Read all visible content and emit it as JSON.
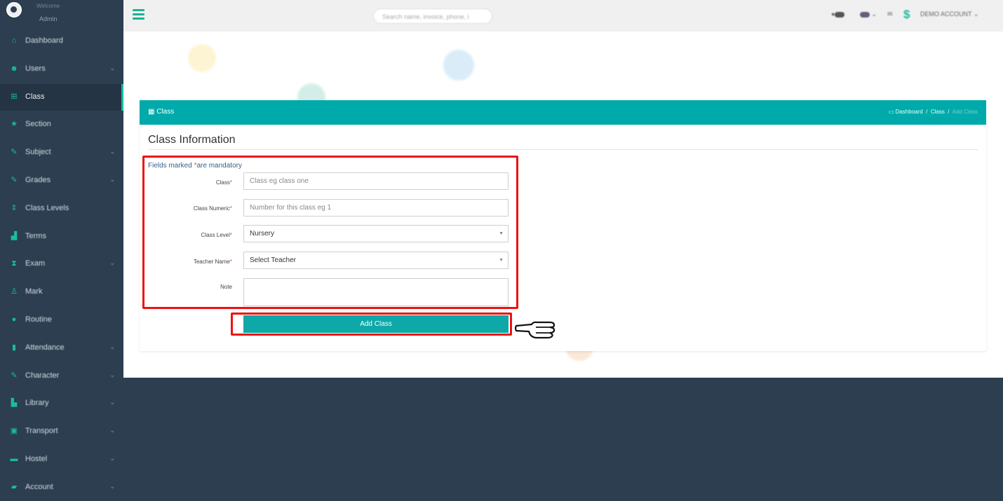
{
  "sidebar": {
    "welcome": "Welcome",
    "user": "Admin",
    "items": [
      {
        "label": "Dashboard",
        "icon": "home-icon",
        "chevron": ""
      },
      {
        "label": "Users",
        "icon": "users-icon",
        "chevron": "⌄"
      },
      {
        "label": "Class",
        "icon": "sitemap-icon",
        "chevron": ""
      },
      {
        "label": "Section",
        "icon": "star-icon",
        "chevron": ""
      },
      {
        "label": "Subject",
        "icon": "edit-icon",
        "chevron": "⌄"
      },
      {
        "label": "Grades",
        "icon": "edit-icon",
        "chevron": "⌄"
      },
      {
        "label": "Class Levels",
        "icon": "sort-icon",
        "chevron": ""
      },
      {
        "label": "Terms",
        "icon": "bar-chart-icon",
        "chevron": ""
      },
      {
        "label": "Exam",
        "icon": "hourglass-icon",
        "chevron": "⌄"
      },
      {
        "label": "Mark",
        "icon": "user-icon",
        "chevron": ""
      },
      {
        "label": "Routine",
        "icon": "clock-icon",
        "chevron": ""
      },
      {
        "label": "Attendance",
        "icon": "clipboard-icon",
        "chevron": "⌄"
      },
      {
        "label": "Character",
        "icon": "edit-icon",
        "chevron": "⌄"
      },
      {
        "label": "Library",
        "icon": "book-icon",
        "chevron": "⌄"
      },
      {
        "label": "Transport",
        "icon": "bus-icon",
        "chevron": "⌄"
      },
      {
        "label": "Hostel",
        "icon": "bed-icon",
        "chevron": "⌄"
      },
      {
        "label": "Account",
        "icon": "money-icon",
        "chevron": "⌄"
      }
    ]
  },
  "topbar": {
    "search_placeholder": "Search name, invoice, phone, i",
    "account": "DEMO ACCOUNT ⌄"
  },
  "panel": {
    "title": "Class",
    "breadcrumb": [
      "Dashboard",
      "Class",
      "Add Class"
    ],
    "heading": "Class Information",
    "mandatory_prefix": "Fields marked ",
    "mandatory_star": "*",
    "mandatory_suffix": "are mandatory"
  },
  "form": {
    "class_label": "Class",
    "class_placeholder": "Class eg class one",
    "numeric_label": "Class Numeric",
    "numeric_placeholder": "Number for this class eg 1",
    "level_label": "Class Level",
    "level_value": "Nursery",
    "teacher_label": "Teacher Name",
    "teacher_value": "Select Teacher",
    "note_label": "Note",
    "required_star": "*",
    "submit_label": "Add Class"
  },
  "colors": {
    "sidebar": "#2c3e50",
    "accent": "#00aaaa",
    "highlight": "#ee1111"
  }
}
